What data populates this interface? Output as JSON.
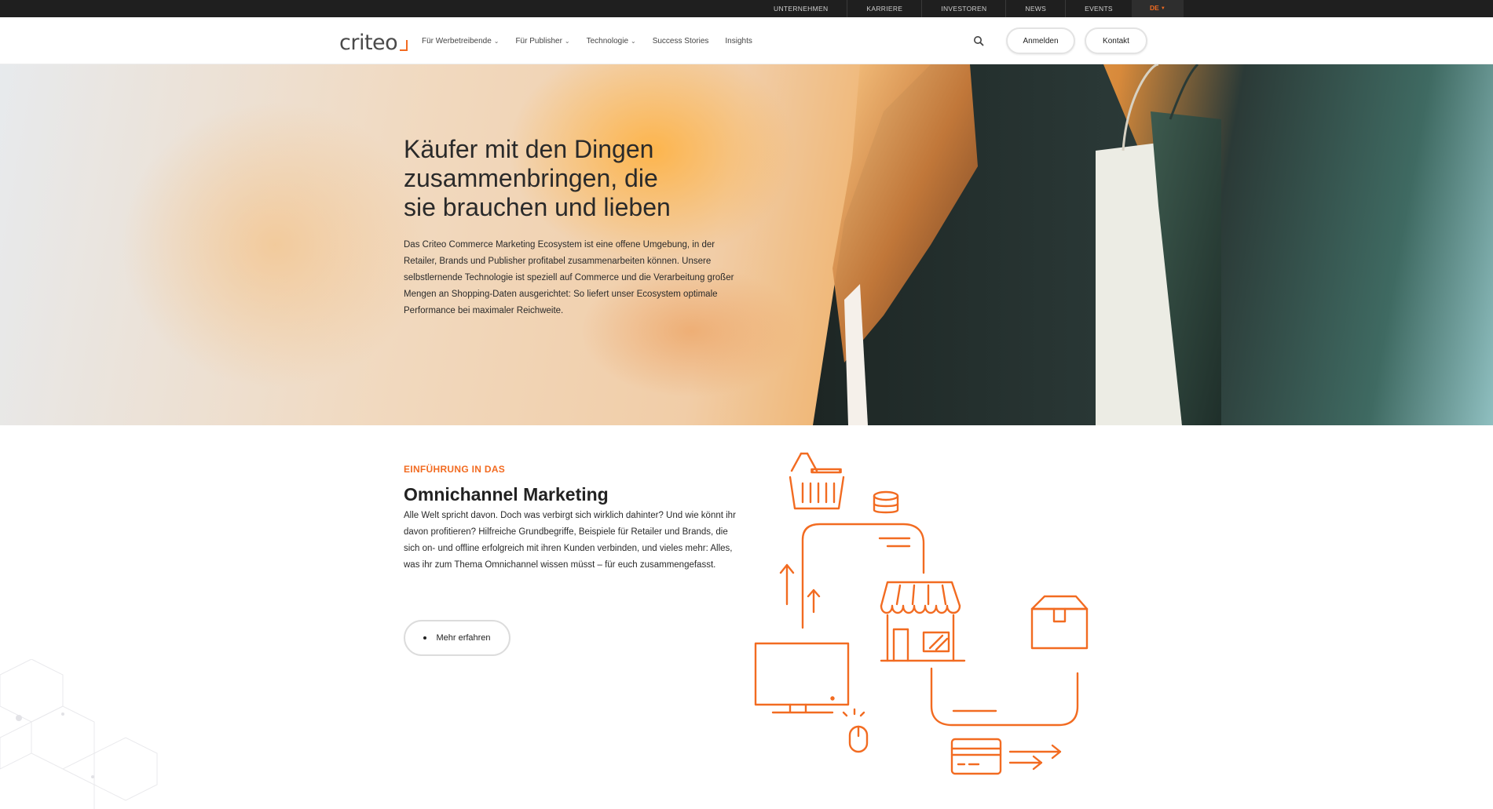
{
  "topbar": {
    "items": [
      "UNTERNEHMEN",
      "KARRIERE",
      "INVESTOREN",
      "NEWS",
      "EVENTS"
    ],
    "lang": "DE"
  },
  "header": {
    "logo_text": "criteo",
    "nav": [
      {
        "label": "Für Werbetreibende",
        "has_dropdown": true
      },
      {
        "label": "Für Publisher",
        "has_dropdown": true
      },
      {
        "label": "Technologie",
        "has_dropdown": true
      },
      {
        "label": "Success Stories",
        "has_dropdown": false
      },
      {
        "label": "Insights",
        "has_dropdown": false
      }
    ],
    "search_icon": "search-icon",
    "login_label": "Anmelden",
    "contact_label": "Kontakt"
  },
  "hero": {
    "title_lines": [
      "Käufer mit den Dingen",
      "zusammenbringen, die",
      "sie brauchen und lieben"
    ],
    "body": "Das Criteo Commerce Marketing Ecosystem ist eine offene Umgebung, in der Retailer, Brands und Publisher profitabel zusammenarbeiten können. Unsere selbstlernende Technologie ist speziell auf Commerce und die Verarbeitung großer Mengen an Shopping-Daten ausgerichtet: So liefert unser Ecosystem optimale Performance bei maximaler Reichweite."
  },
  "intro": {
    "eyebrow": "EINFÜHRUNG IN DAS",
    "title": "Omnichannel Marketing",
    "body": "Alle Welt spricht davon. Doch was verbirgt sich wirklich dahinter? Und wie könnt ihr davon profitieren? Hilfreiche Grundbegriffe, Beispiele für Retailer und Brands, die sich on- und offline erfolgreich mit ihren Kunden verbinden, und vieles mehr: Alles, was ihr zum Thema Omnichannel wissen müsst – für euch zusammengefasst.",
    "button_label": "Mehr erfahren"
  },
  "colors": {
    "accent": "#f26b21",
    "topbar_bg": "#1f1f1f",
    "text": "#2a2a2a"
  }
}
